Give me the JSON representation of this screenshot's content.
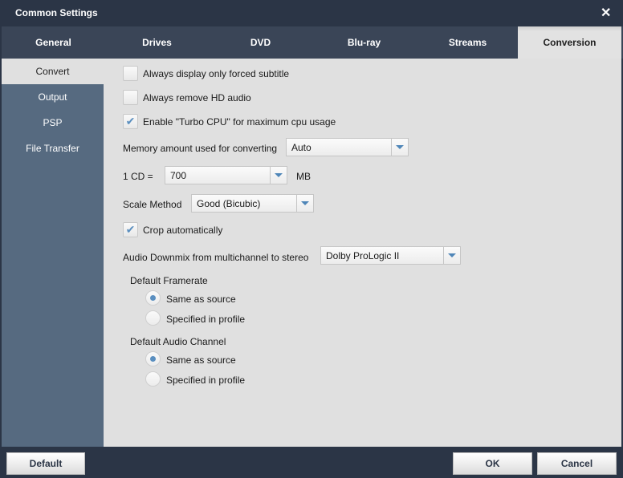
{
  "window": {
    "title": "Common Settings",
    "close": "✕"
  },
  "tabs": [
    "General",
    "Drives",
    "DVD",
    "Blu-ray",
    "Streams",
    "Conversion"
  ],
  "sidebar": [
    "Convert",
    "Output",
    "PSP",
    "File Transfer"
  ],
  "options": {
    "forced_subtitle": {
      "label": "Always display only forced subtitle",
      "checked": false
    },
    "remove_hd_audio": {
      "label": "Always remove HD audio",
      "checked": false
    },
    "turbo_cpu": {
      "label": "Enable \"Turbo CPU\" for maximum cpu usage",
      "checked": true
    },
    "memory": {
      "label": "Memory amount used for converting",
      "value": "Auto"
    },
    "cd": {
      "label": "1 CD =",
      "value": "700",
      "unit": "MB"
    },
    "scale": {
      "label": "Scale Method",
      "value": "Good (Bicubic)"
    },
    "crop": {
      "label": "Crop automatically",
      "checked": true
    },
    "downmix": {
      "label": "Audio Downmix from multichannel to stereo",
      "value": "Dolby ProLogic II"
    },
    "framerate": {
      "label": "Default Framerate",
      "opt1": "Same as source",
      "opt2": "Specified in profile",
      "selected": 1
    },
    "audio_channel": {
      "label": "Default Audio Channel",
      "opt1": "Same as source",
      "opt2": "Specified in profile",
      "selected": 1
    }
  },
  "buttons": {
    "default": "Default",
    "ok": "OK",
    "cancel": "Cancel"
  }
}
